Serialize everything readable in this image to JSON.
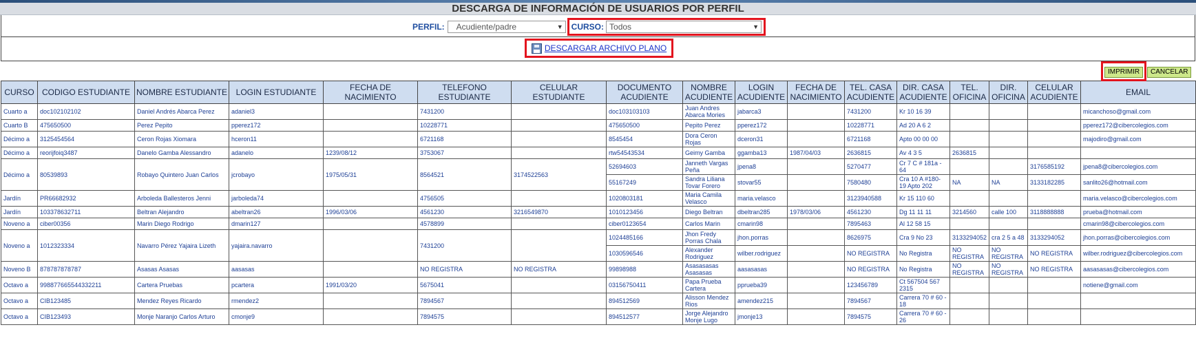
{
  "page": {
    "title": "DESCARGA DE INFORMACIÓN DE USUARIOS POR PERFIL"
  },
  "filters": {
    "perfil_label": "PERFIL:",
    "perfil_value": "Acudiente/padre",
    "curso_label": "CURSO:",
    "curso_value": "Todos",
    "dropdown_icon": "chevron-down-icon"
  },
  "download": {
    "label": "DESCARGAR ARCHIVO PLANO",
    "icon": "floppy-disk-icon"
  },
  "actions": {
    "print_label": "IMPRIMIR",
    "cancel_label": "CANCELAR"
  },
  "colors": {
    "header_bg": "#cfddf0",
    "link_blue": "#1a33c8",
    "highlight_red": "#e3141e",
    "button_green": "#cde88a"
  },
  "table": {
    "headers": [
      "CURSO",
      "CODIGO ESTUDIANTE",
      "NOMBRE ESTUDIANTE",
      "LOGIN ESTUDIANTE",
      "FECHA DE NACIMIENTO",
      "TELEFONO ESTUDIANTE",
      "CELULAR ESTUDIANTE",
      "DOCUMENTO ACUDIENTE",
      "NOMBRE ACUDIENTE",
      "LOGIN ACUDIENTE",
      "FECHA DE NACIMIENTO",
      "TEL. CASA ACUDIENTE",
      "DIR. CASA ACUDIENTE",
      "TEL. OFICINA",
      "DIR. OFICINA",
      "CELULAR ACUDIENTE",
      "EMAIL"
    ],
    "students": [
      {
        "curso": "Cuarto a",
        "codigo": "doc102102102",
        "nombre": "Daniel Andrés Abarca Perez",
        "login": "adaniel3",
        "fecha": "",
        "telefono": "7431200",
        "celular": "",
        "acudientes": [
          {
            "documento": "doc103103103",
            "nombre": "Juan Andres Abarca Mories",
            "login": "jabarca3",
            "fecha": "",
            "tel_casa": "7431200",
            "dir_casa": "Kr 10 16 39",
            "tel_oficina": "",
            "dir_oficina": "",
            "celular": "",
            "email": "micanchoso@gmail.com"
          }
        ]
      },
      {
        "curso": "Cuarto B",
        "codigo": "475650500",
        "nombre": "Perez Pepito",
        "login": "pperez172",
        "fecha": "",
        "telefono": "10228771",
        "celular": "",
        "acudientes": [
          {
            "documento": "475650500",
            "nombre": "Pepito Perez",
            "login": "pperez172",
            "fecha": "",
            "tel_casa": "10228771",
            "dir_casa": "Ad 20 A 6 2",
            "tel_oficina": "",
            "dir_oficina": "",
            "celular": "",
            "email": "pperez172@cibercolegios.com"
          }
        ]
      },
      {
        "curso": "Décimo a",
        "codigo": "3125454564",
        "nombre": "Ceron Rojas Xiomara",
        "login": "hceron11",
        "fecha": "",
        "telefono": "6721168",
        "celular": "",
        "acudientes": [
          {
            "documento": "8545454",
            "nombre": "Dora Ceron Rojas",
            "login": "dceron31",
            "fecha": "",
            "tel_casa": "6721168",
            "dir_casa": "Apto 00 00 00",
            "tel_oficina": "",
            "dir_oficina": "",
            "celular": "",
            "email": "majodiro@gmail.com"
          }
        ]
      },
      {
        "curso": "Décimo a",
        "codigo": "reorijfoiq3487",
        "nombre": "Danelo Gamba Alessandro",
        "login": "adanelo",
        "fecha": "1239/08/12",
        "telefono": "3753067",
        "celular": "",
        "acudientes": [
          {
            "documento": "rtw54543534",
            "nombre": "Geimy Gamba",
            "login": "ggamba13",
            "fecha": "1987/04/03",
            "tel_casa": "2636815",
            "dir_casa": "Av 4 3 5",
            "tel_oficina": "2636815",
            "dir_oficina": "",
            "celular": "",
            "email": ""
          }
        ]
      },
      {
        "curso": "Décimo a",
        "codigo": "80539893",
        "nombre": "Robayo Quintero Juan Carlos",
        "login": "jcrobayo",
        "fecha": "1975/05/31",
        "telefono": "8564521",
        "celular": "3174522563",
        "acudientes": [
          {
            "documento": "52694603",
            "nombre": "Janneth Vargas Peña",
            "login": "jpena8",
            "fecha": "",
            "tel_casa": "5270477",
            "dir_casa": "Cr 7 C # 181a - 64",
            "tel_oficina": "",
            "dir_oficina": "",
            "celular": "3176585192",
            "email": "jpena8@cibercolegios.com"
          },
          {
            "documento": "55167249",
            "nombre": "Sandra Liliana Tovar Forero",
            "login": "stovar55",
            "fecha": "",
            "tel_casa": "7580480",
            "dir_casa": "Cra 10 A #180-19 Apto 202",
            "tel_oficina": "NA",
            "dir_oficina": "NA",
            "celular": "3133182285",
            "email": "sanlito26@hotmail.com"
          }
        ]
      },
      {
        "curso": "Jardín",
        "codigo": "PR66682932",
        "nombre": "Arboleda Ballesteros Jenni",
        "login": "jarboleda74",
        "fecha": "",
        "telefono": "4756505",
        "celular": "",
        "acudientes": [
          {
            "documento": "1020803181",
            "nombre": "Maria Camila Velasco",
            "login": "maria.velasco",
            "fecha": "",
            "tel_casa": "3123940588",
            "dir_casa": "Kr 15 110 60",
            "tel_oficina": "",
            "dir_oficina": "",
            "celular": "",
            "email": "maria.velasco@cibercolegios.com"
          }
        ]
      },
      {
        "curso": "Jardín",
        "codigo": "103378632711",
        "nombre": "Beltran Alejandro",
        "login": "abeltran26",
        "fecha": "1996/03/06",
        "telefono": "4561230",
        "celular": "3216549870",
        "acudientes": [
          {
            "documento": "1010123456",
            "nombre": "Diego Beltran",
            "login": "dbeltran285",
            "fecha": "1978/03/06",
            "tel_casa": "4561230",
            "dir_casa": "Dg 11 11 11",
            "tel_oficina": "3214560",
            "dir_oficina": "calle 100",
            "celular": "3118888888",
            "email": "prueba@hotmail.com"
          }
        ]
      },
      {
        "curso": "Noveno a",
        "codigo": "ciber00356",
        "nombre": "Marin Diego Rodrigo",
        "login": "dmarin127",
        "fecha": "",
        "telefono": "4578899",
        "celular": "",
        "acudientes": [
          {
            "documento": "ciber0123654",
            "nombre": "Carlos Marin",
            "login": "cmarin98",
            "fecha": "",
            "tel_casa": "7895463",
            "dir_casa": "Al 12 58 15",
            "tel_oficina": "",
            "dir_oficina": "",
            "celular": "",
            "email": "cmarin98@cibercolegios.com"
          }
        ]
      },
      {
        "curso": "Noveno a",
        "codigo": "1012323334",
        "nombre": "Navarro Pérez Yajaira Lizeth",
        "login": "yajaira.navarro",
        "fecha": "",
        "telefono": "7431200",
        "celular": "",
        "acudientes": [
          {
            "documento": "1024485166",
            "nombre": "Jhon Fredy Porras Chala",
            "login": "jhon.porras",
            "fecha": "",
            "tel_casa": "8626975",
            "dir_casa": "Cra 9 No 23",
            "tel_oficina": "3133294052",
            "dir_oficina": "cra 2 5 a 48",
            "celular": "3133294052",
            "email": "jhon.porras@cibercolegios.com"
          },
          {
            "documento": "1030596546",
            "nombre": "Alexander Rodriguez",
            "login": "wilber.rodriguez",
            "fecha": "",
            "tel_casa": "NO REGISTRA",
            "dir_casa": "No Registra",
            "tel_oficina": "NO REGISTRA",
            "dir_oficina": "NO REGISTRA",
            "celular": "NO REGISTRA",
            "email": "wilber.rodriguez@cibercolegios.com"
          }
        ]
      },
      {
        "curso": "Noveno B",
        "codigo": "878787878787",
        "nombre": "Asasas Asasas",
        "login": "aasasas",
        "fecha": "",
        "telefono": "NO REGISTRA",
        "celular": "NO REGISTRA",
        "acudientes": [
          {
            "documento": "99898988",
            "nombre": "Asasasasas Asasasas",
            "login": "aasasasas",
            "fecha": "",
            "tel_casa": "NO REGISTRA",
            "dir_casa": "No Registra",
            "tel_oficina": "NO REGISTRA",
            "dir_oficina": "NO REGISTRA",
            "celular": "NO REGISTRA",
            "email": "aasasasas@cibercolegios.com"
          }
        ]
      },
      {
        "curso": "Octavo a",
        "codigo": "998877665544332211",
        "nombre": "Cartera Pruebas",
        "login": "pcartera",
        "fecha": "1991/03/20",
        "telefono": "5675041",
        "celular": "",
        "acudientes": [
          {
            "documento": "03156750411",
            "nombre": "Papa Prueba Cartera",
            "login": "pprueba39",
            "fecha": "",
            "tel_casa": "123456789",
            "dir_casa": "Ct 567504 567 2315",
            "tel_oficina": "",
            "dir_oficina": "",
            "celular": "",
            "email": "notiene@gmail.com"
          }
        ]
      },
      {
        "curso": "Octavo a",
        "codigo": "CIB123485",
        "nombre": "Mendez Reyes Ricardo",
        "login": "rmendez2",
        "fecha": "",
        "telefono": "7894567",
        "celular": "",
        "acudientes": [
          {
            "documento": "894512569",
            "nombre": "Alisson Mendez Rios",
            "login": "amendez215",
            "fecha": "",
            "tel_casa": "7894567",
            "dir_casa": "Carrera 70 # 60 - 18",
            "tel_oficina": "",
            "dir_oficina": "",
            "celular": "",
            "email": ""
          }
        ]
      },
      {
        "curso": "Octavo a",
        "codigo": "CIB123493",
        "nombre": "Monje Naranjo Carlos Arturo",
        "login": "cmonje9",
        "fecha": "",
        "telefono": "7894575",
        "celular": "",
        "acudientes": [
          {
            "documento": "894512577",
            "nombre": "Jorge Alejandro Monje Lugo",
            "login": "jmonje13",
            "fecha": "",
            "tel_casa": "7894575",
            "dir_casa": "Carrera 70 # 60 - 26",
            "tel_oficina": "",
            "dir_oficina": "",
            "celular": "",
            "email": ""
          }
        ]
      }
    ]
  }
}
